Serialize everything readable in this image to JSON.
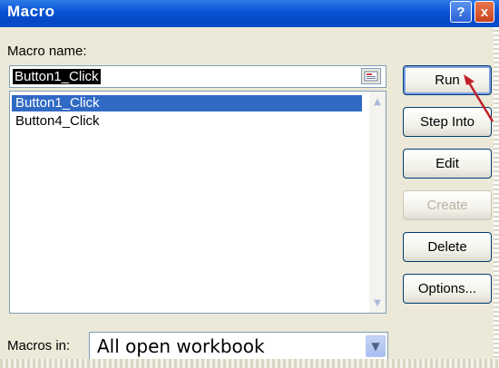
{
  "window": {
    "title": "Macro",
    "help_icon": "?",
    "close_icon": "x"
  },
  "macro_name": {
    "label": "Macro name:",
    "value": "Button1_Click"
  },
  "macro_list": {
    "items": [
      {
        "label": "Button1_Click",
        "selected": true
      },
      {
        "label": "Button4_Click",
        "selected": false
      }
    ]
  },
  "buttons": {
    "run": "Run",
    "step_into": "Step Into",
    "edit": "Edit",
    "create": "Create",
    "delete": "Delete",
    "options": "Options..."
  },
  "macros_in": {
    "label": "Macros in:",
    "value": "All open workbook"
  },
  "colors": {
    "title_bar": "#0a52d3",
    "selection": "#316ac5",
    "arrow": "#c0202a"
  }
}
